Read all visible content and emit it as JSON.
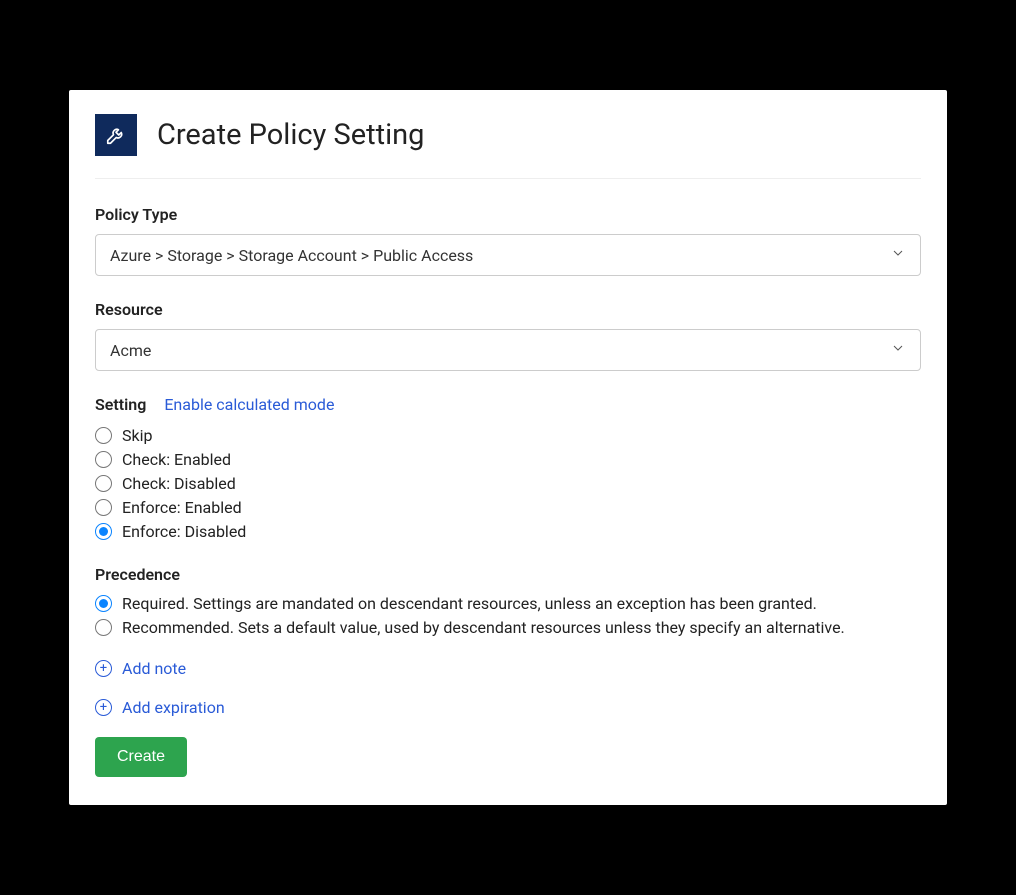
{
  "header": {
    "title": "Create Policy Setting"
  },
  "policyType": {
    "label": "Policy Type",
    "value": "Azure > Storage > Storage Account > Public Access"
  },
  "resource": {
    "label": "Resource",
    "value": "Acme"
  },
  "setting": {
    "label": "Setting",
    "calculatedModeLink": "Enable calculated mode",
    "options": [
      {
        "label": "Skip",
        "selected": false
      },
      {
        "label": "Check: Enabled",
        "selected": false
      },
      {
        "label": "Check: Disabled",
        "selected": false
      },
      {
        "label": "Enforce: Enabled",
        "selected": false
      },
      {
        "label": "Enforce: Disabled",
        "selected": true
      }
    ]
  },
  "precedence": {
    "label": "Precedence",
    "options": [
      {
        "label": "Required. Settings are mandated on descendant resources, unless an exception has been granted.",
        "selected": true
      },
      {
        "label": "Recommended. Sets a default value, used by descendant resources unless they specify an alternative.",
        "selected": false
      }
    ]
  },
  "actions": {
    "addNote": "Add note",
    "addExpiration": "Add expiration",
    "create": "Create"
  }
}
